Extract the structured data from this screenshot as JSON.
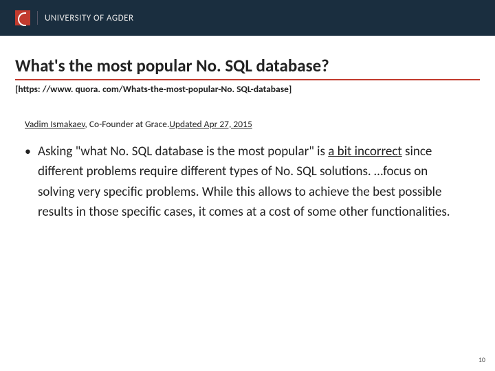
{
  "header": {
    "institution": "UNIVERSITY OF AGDER"
  },
  "title": "What's the most popular No. SQL database?",
  "url": "[https: //www. quora. com/Whats-the-most-popular-No. SQL-database]",
  "author": {
    "name": "Vadim Ismakaev",
    "role": ", Co-Founder at Grace.",
    "updated": "Updated Apr 27, 2015"
  },
  "body": {
    "pre": "Asking \"what No. SQL database is the most popular\" is ",
    "underlined": "a bit incorrect",
    "post": " since different problems require different types of No. SQL solutions. …focus on solving very specific problems. While this allows to achieve the best possible results in those specific cases, it comes at a cost of some other functionalities."
  },
  "page_number": "10"
}
